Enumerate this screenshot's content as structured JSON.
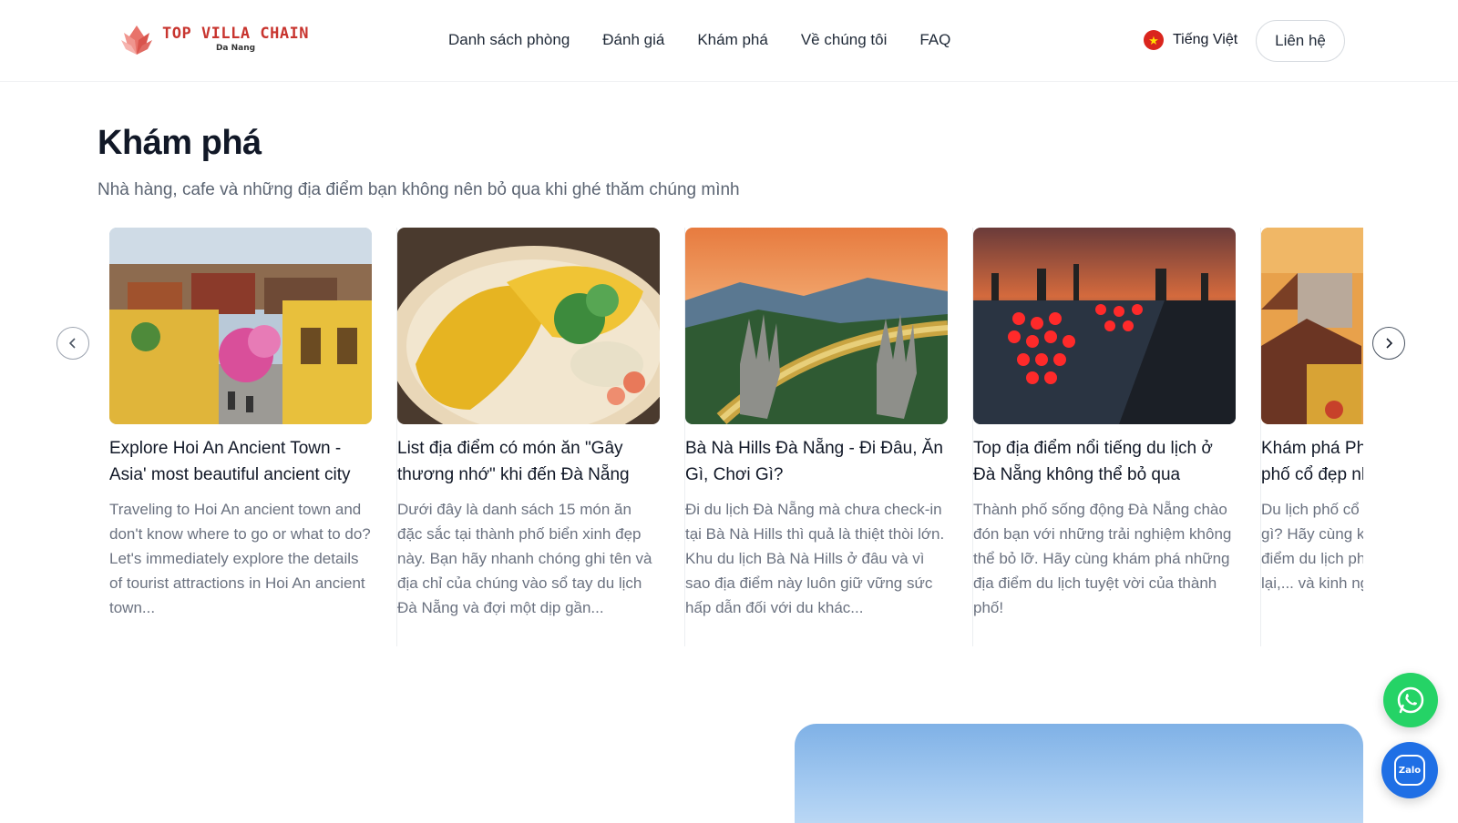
{
  "header": {
    "logo": {
      "title": "TOP VILLA CHAIN",
      "subtitle": "Da Nang"
    },
    "nav": [
      {
        "label": "Danh sách phòng"
      },
      {
        "label": "Đánh giá"
      },
      {
        "label": "Khám phá"
      },
      {
        "label": "Về chúng tôi"
      },
      {
        "label": "FAQ"
      }
    ],
    "language": {
      "label": "Tiếng Việt",
      "flag_icon": "vietnam-flag-icon"
    },
    "contact_label": "Liên hệ"
  },
  "section": {
    "title": "Khám phá",
    "subtitle": "Nhà hàng, cafe và những địa điểm bạn không nên bỏ qua khi ghé thăm chúng mình"
  },
  "cards": [
    {
      "title": "Explore Hoi An Ancient Town - Asia' most beautiful ancient city",
      "description": "Traveling to Hoi An ancient town and don't know where to go or what to do? Let's immediately explore the details of tourist attractions in Hoi An ancient town..."
    },
    {
      "title": "List địa điểm có món ăn \"Gây thương nhớ\" khi đến Đà Nẵng",
      "description": "Dưới đây là danh sách 15 món ăn đặc sắc tại thành phố biển xinh đẹp này. Bạn hãy nhanh chóng ghi tên và địa chỉ của chúng vào sổ tay du lịch Đà Nẵng và đợi một dịp gần..."
    },
    {
      "title": "Bà Nà Hills Đà Nẵng - Đi Đâu, Ăn Gì, Chơi Gì?",
      "description": "Đi du lịch Đà Nẵng mà chưa check-in tại Bà Nà Hills thì quả là thiệt thòi lớn. Khu du lịch Bà Nà Hills ở đâu và vì sao địa điểm này luôn giữ vững sức hấp dẫn đối với du khác..."
    },
    {
      "title": "Top địa điểm nổi tiếng du lịch ở Đà Nẵng không thể bỏ qua",
      "description": "Thành phố sống động Đà Nẵng chào đón bạn với những trải nghiệm không thể bỏ lỡ. Hãy cùng khám phá những địa điểm du lịch tuyệt vời của thành phố!"
    },
    {
      "title": "Khám phá Phố cổ Hội An - Thành phố cổ đẹp nhất Châu Á",
      "description": "Du lịch phố cổ Hội An nên đi đâu, làm gì? Hãy cùng khám phá chi tiết các điểm du lịch phố cổ Hội An, review đi lại,... và kinh nghiệm"
    }
  ],
  "floating": {
    "whatsapp_icon": "whatsapp-icon",
    "zalo_label": "Zalo"
  }
}
